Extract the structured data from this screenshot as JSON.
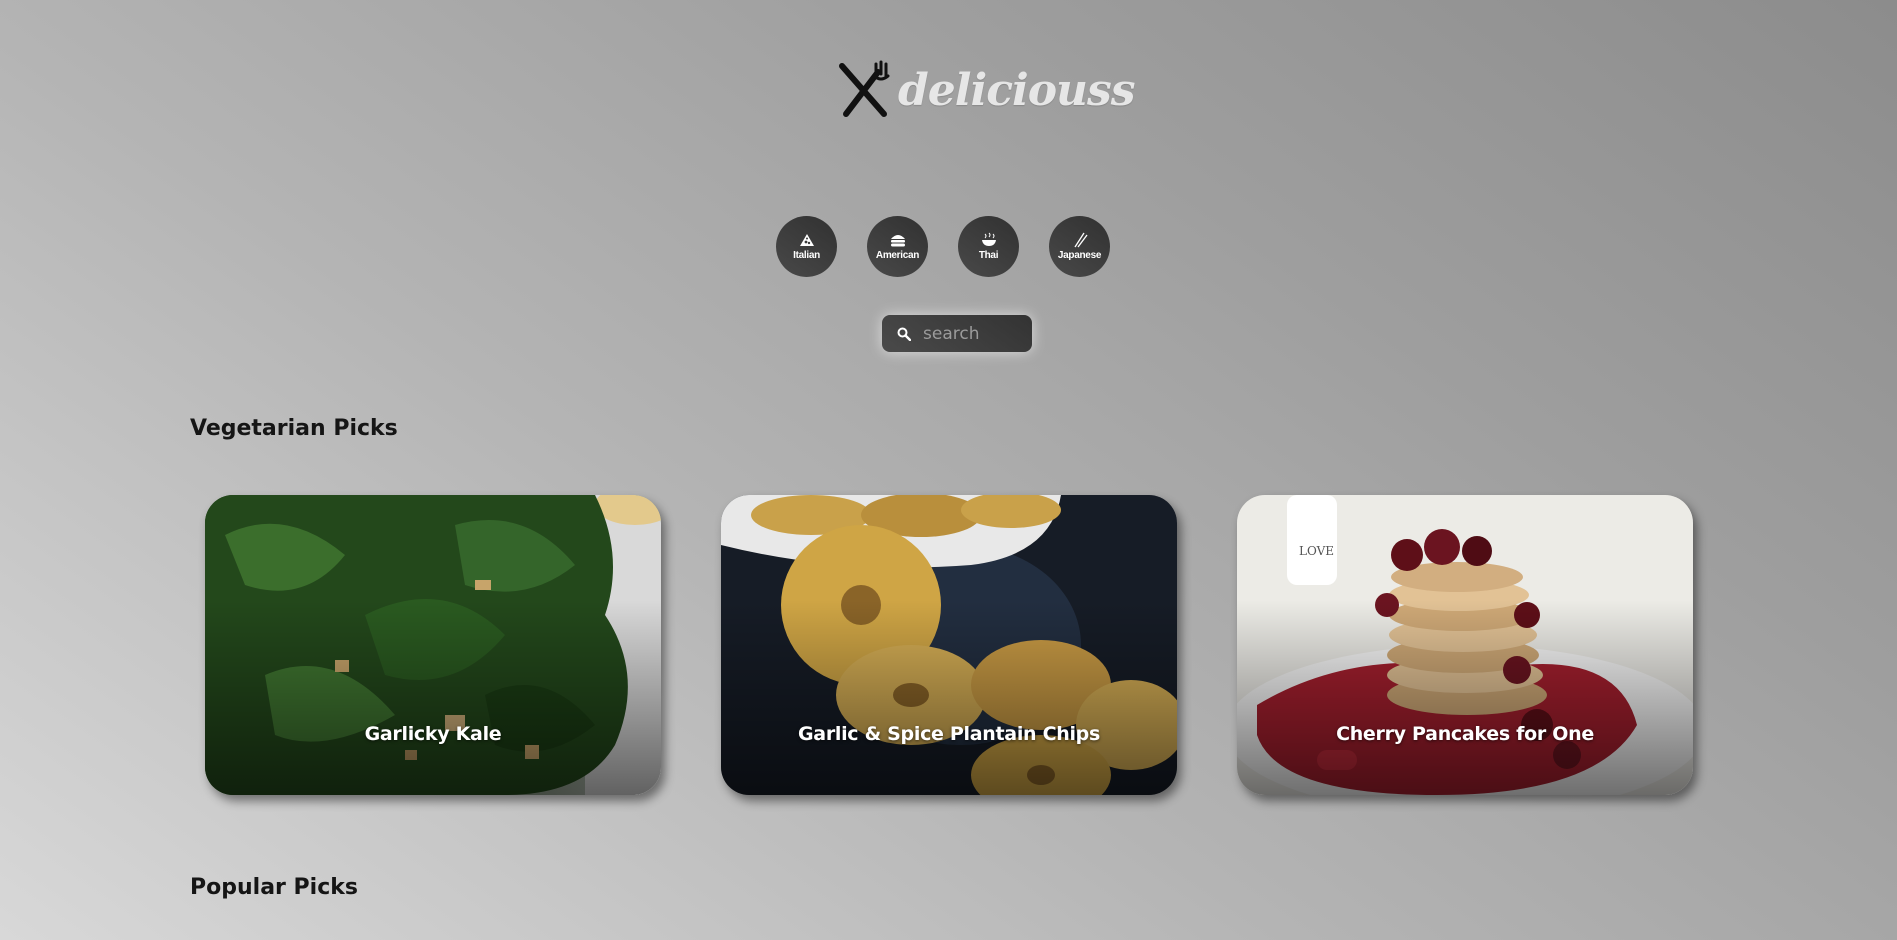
{
  "brand": {
    "name": "deliciouss",
    "icon": "cutlery-icon"
  },
  "cuisines": [
    {
      "label": "Italian",
      "icon": "pizza-icon"
    },
    {
      "label": "American",
      "icon": "burger-icon"
    },
    {
      "label": "Thai",
      "icon": "noodle-bowl-icon"
    },
    {
      "label": "Japanese",
      "icon": "chopsticks-icon"
    }
  ],
  "search": {
    "placeholder": "search",
    "value": ""
  },
  "sections": {
    "vegetarian": {
      "title": "Vegetarian Picks",
      "cards": [
        {
          "title": "Garlicky Kale"
        },
        {
          "title": "Garlic & Spice Plantain Chips"
        },
        {
          "title": "Cherry Pancakes for One"
        }
      ]
    },
    "popular": {
      "title": "Popular Picks"
    }
  }
}
